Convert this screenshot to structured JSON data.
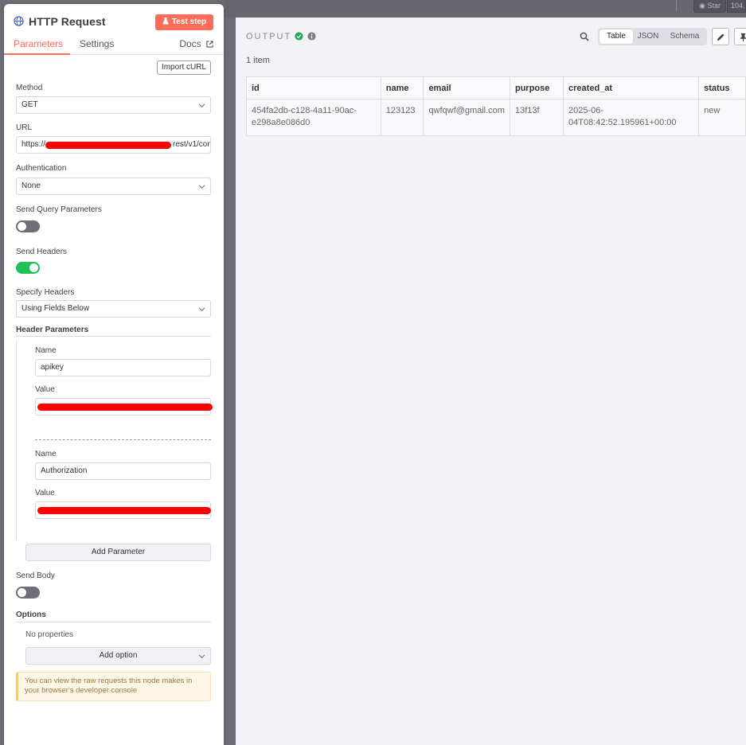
{
  "topbar": {
    "star_label": "Star",
    "star_count": "104."
  },
  "node": {
    "title": "HTTP Request",
    "test_button": "Test step",
    "tabs": {
      "parameters": "Parameters",
      "settings": "Settings",
      "docs": "Docs"
    },
    "import_curl": "Import cURL"
  },
  "params": {
    "method_label": "Method",
    "method_value": "GET",
    "url_label": "URL",
    "url_prefix": "https://",
    "url_suffix": "rest/v1/con",
    "auth_label": "Authentication",
    "auth_value": "None",
    "send_query_label": "Send Query Parameters",
    "send_query_on": false,
    "send_headers_label": "Send Headers",
    "send_headers_on": true,
    "specify_headers_label": "Specify Headers",
    "specify_headers_value": "Using Fields Below",
    "header_params_label": "Header Parameters",
    "headers": [
      {
        "name_label": "Name",
        "name_value": "apikey",
        "value_label": "Value"
      },
      {
        "name_label": "Name",
        "name_value": "Authorization",
        "value_label": "Value"
      }
    ],
    "add_parameter": "Add Parameter",
    "send_body_label": "Send Body",
    "send_body_on": false,
    "options_label": "Options",
    "no_properties": "No properties",
    "add_option": "Add option",
    "notice": "You can view the raw requests this node makes in your browser's developer console"
  },
  "output": {
    "title": "OUTPUT",
    "views": [
      "Table",
      "JSON",
      "Schema"
    ],
    "active_view": "Table",
    "item_count": "1 item",
    "columns": [
      "id",
      "name",
      "email",
      "purpose",
      "created_at",
      "status"
    ],
    "rows": [
      {
        "id": "454fa2db-c128-4a11-90ac-e298a8e086d0",
        "name": "123123",
        "email": "qwfqwf@gmail.com",
        "purpose": "13f13f",
        "created_at": "2025-06-04T08:42:52.195961+00:00",
        "status": "new"
      }
    ]
  },
  "colors": {
    "accent": "#ff6d5a",
    "toggle_on": "#1fbf5a",
    "success": "#1fa85a",
    "redaction": "#ff0000"
  }
}
